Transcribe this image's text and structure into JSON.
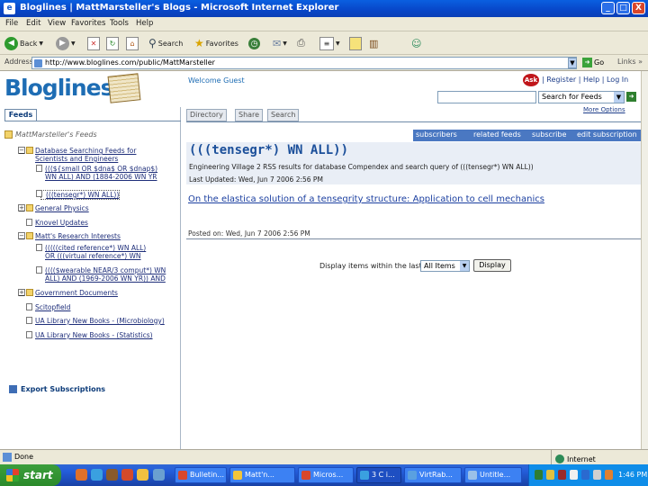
{
  "window": {
    "title": "Bloglines | MattMarsteller's Blogs - Microsoft Internet Explorer",
    "min_label": "_",
    "max_label": "□",
    "close_label": "X"
  },
  "menu": [
    "File",
    "Edit",
    "View",
    "Favorites",
    "Tools",
    "Help"
  ],
  "toolbar": {
    "back_label": "Back",
    "search_label": "Search",
    "favorites_label": "Favorites"
  },
  "address": {
    "label": "Address",
    "url": "http://www.bloglines.com/public/MattMarsteller",
    "go_label": "Go",
    "links_label": "Links",
    "more_label": "»"
  },
  "page": {
    "logo_text": "Bloglines",
    "welcome": "Welcome Guest",
    "ask_label": "Ask",
    "top_links": "| Register | Help | Log In",
    "search_select": "Search for Feeds",
    "more_options": "More Options"
  },
  "left": {
    "tab_feeds": "Feeds",
    "header": "MattMarsteller's Feeds",
    "tree": [
      {
        "exp": "−",
        "lines": [
          "Database Searching Feeds for",
          "Scientists and Engineers"
        ],
        "folder": true
      },
      {
        "exp": "",
        "lines": [
          "(((${small OR $dna$ OR $dnap$)",
          "WN ALL) AND (1884-2006 WN YR"
        ],
        "folder": false
      },
      {
        "exp": "",
        "lines": [
          "(((tensegr*) WN ALL))"
        ],
        "folder": false
      },
      {
        "exp": "+",
        "lines": [
          "General Physics"
        ],
        "folder": true
      },
      {
        "exp": "",
        "lines": [
          "Knovel Updates"
        ],
        "folder": false
      },
      {
        "exp": "−",
        "lines": [
          "Matt's Research Interests"
        ],
        "folder": true
      },
      {
        "exp": "",
        "lines": [
          "(((((cited reference*) WN ALL)",
          "OR (((virtual reference*) WN"
        ],
        "folder": false
      },
      {
        "exp": "",
        "lines": [
          "(((($wearable NEAR/3 comput*) WN",
          "ALL) AND (1969-2006 WN YR)) AND"
        ],
        "folder": false
      },
      {
        "exp": "+",
        "lines": [
          "Government Documents"
        ],
        "folder": true
      },
      {
        "exp": "",
        "lines": [
          "Scitopfield"
        ],
        "folder": false
      },
      {
        "exp": "",
        "lines": [
          "UA Library New Books - (Microbiology)"
        ],
        "folder": false
      },
      {
        "exp": "",
        "lines": [
          "UA Library New Books - (Statistics)"
        ],
        "folder": false
      }
    ],
    "export": "Export Subscriptions"
  },
  "right": {
    "tabs": [
      "Directory",
      "Share",
      "Search"
    ],
    "bar_links": [
      "subscribers",
      "related feeds",
      "subscribe",
      "edit subscription"
    ],
    "result_title": "(((tensegr*) WN ALL))",
    "result_desc": "Engineering Village 2 RSS results for database Compendex and search query of (((tensegr*) WN ALL))",
    "result_updated": "Last Updated: Wed, Jun 7 2006 2:56 PM",
    "article_link": "On the elastica solution of a tensegrity structure: Application to cell mechanics",
    "posted": "Posted on: Wed, Jun 7 2006 2:56 PM",
    "display_label": "Display items within the last",
    "display_select": "All Items",
    "display_button": "Display"
  },
  "status": {
    "text": "Done",
    "zone": "Internet"
  },
  "taskbar": {
    "start_label": "start",
    "tasks": [
      "Bulletin...",
      "Matt'n...",
      "Micros...",
      "3 C i...",
      "VirtRab...",
      "Untitle..."
    ],
    "clock": "1:46 PM"
  }
}
